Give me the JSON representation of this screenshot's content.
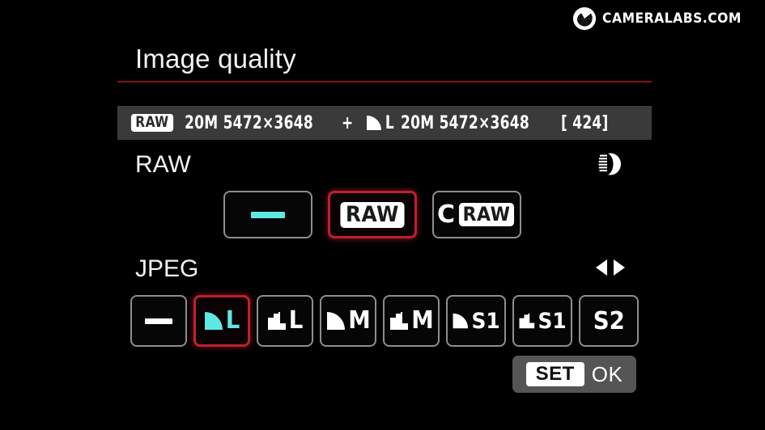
{
  "watermark": {
    "text": "CAMERALABS.COM",
    "icon": "shutter-icon"
  },
  "header": {
    "title": "Image quality",
    "rule_color": "#7d1420"
  },
  "info_bar": {
    "raw_badge": "RAW",
    "raw_size": "20M 5472×3648",
    "plus": "+",
    "jpeg_quality_label": "L",
    "jpeg_size": "20M 5472×3648",
    "shots_remaining": "[  424]",
    "background": "#3a3a3a"
  },
  "raw_section": {
    "label": "RAW",
    "hint_icon": "main-dial-icon",
    "options": [
      {
        "id": "none",
        "type": "dash",
        "label": "—",
        "selected": false,
        "color": "#5fe8e3"
      },
      {
        "id": "raw",
        "type": "badge",
        "label": "RAW",
        "selected": true,
        "color": "#ffffff"
      },
      {
        "id": "craw",
        "type": "craw",
        "label": "CRAW",
        "prefix": "C",
        "badge": "RAW",
        "selected": false,
        "color": "#ffffff"
      }
    ]
  },
  "jpeg_section": {
    "label": "JPEG",
    "hint_icon": "left-right-arrows-icon",
    "options": [
      {
        "id": "none",
        "type": "dash",
        "label": "—",
        "selected": false,
        "color": "#ffffff"
      },
      {
        "id": "fine-l",
        "type": "quality",
        "icon": "fine",
        "letter": "L",
        "label": "Fine L",
        "selected": true,
        "color": "#5fe8e3"
      },
      {
        "id": "normal-l",
        "type": "quality",
        "icon": "normal",
        "letter": "L",
        "label": "Normal L",
        "selected": false,
        "color": "#ffffff"
      },
      {
        "id": "fine-m",
        "type": "quality",
        "icon": "fine",
        "letter": "M",
        "label": "Fine M",
        "selected": false,
        "color": "#ffffff"
      },
      {
        "id": "normal-m",
        "type": "quality",
        "icon": "normal",
        "letter": "M",
        "label": "Normal M",
        "selected": false,
        "color": "#ffffff"
      },
      {
        "id": "fine-s1",
        "type": "quality",
        "icon": "fine",
        "letter": "S1",
        "label": "Fine S1",
        "selected": false,
        "color": "#ffffff"
      },
      {
        "id": "normal-s1",
        "type": "quality",
        "icon": "normal",
        "letter": "S1",
        "label": "Normal S1",
        "selected": false,
        "color": "#ffffff"
      },
      {
        "id": "s2",
        "type": "text",
        "letter": "S2",
        "label": "S2",
        "selected": false,
        "color": "#ffffff"
      }
    ]
  },
  "footer": {
    "set_label": "SET",
    "ok_label": "OK"
  },
  "colors": {
    "selection_red": "#bf1f2e",
    "accent_cyan": "#5fe8e3",
    "screen_background": "#000000"
  }
}
